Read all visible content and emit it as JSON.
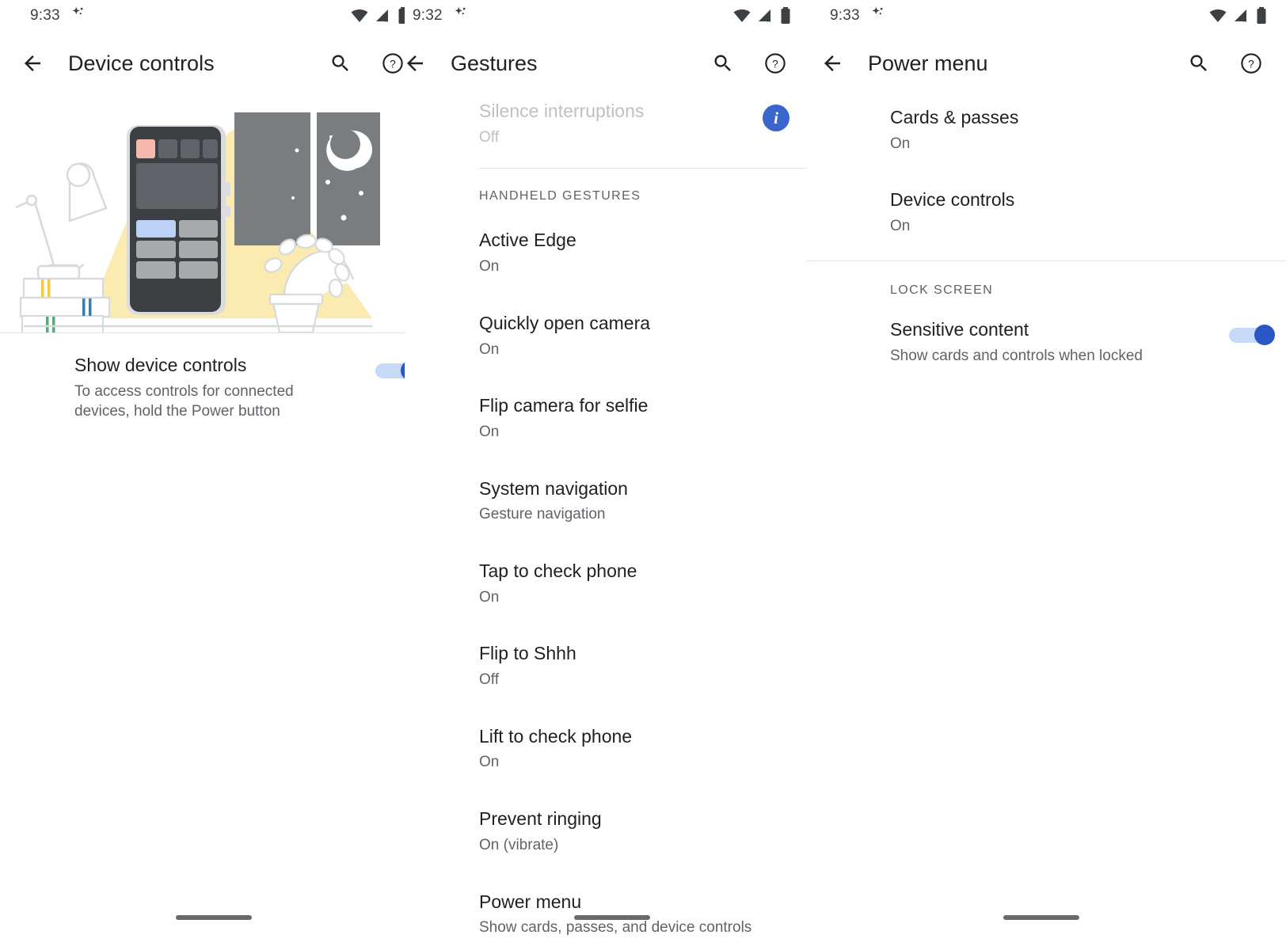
{
  "panels": [
    {
      "status": {
        "time": "9:33",
        "sparkle": "sparkle-icon",
        "wifi": "wifi-icon",
        "signal": "cell-signal-x-icon",
        "battery": "battery-icon"
      },
      "appbar": {
        "back": "back-arrow-icon",
        "title": "Device controls",
        "search": "search-icon",
        "help": "help-circle-icon"
      },
      "illustration": {
        "name": "device-controls-illustration",
        "alt": "Phone showing device control tiles with lamp, books, plant and night window"
      },
      "setting": {
        "title": "Show device controls",
        "subtitle": "To access controls for connected devices, hold the Power button",
        "toggle_on": true
      }
    },
    {
      "status": {
        "time": "9:32",
        "sparkle": "sparkle-icon",
        "wifi": "wifi-icon",
        "signal": "cell-signal-x-icon",
        "battery": "battery-icon"
      },
      "appbar": {
        "back": "back-arrow-icon",
        "title": "Gestures",
        "search": "search-icon",
        "help": "help-circle-icon"
      },
      "top_item": {
        "title": "Silence interruptions",
        "subtitle": "Off",
        "disabled": true,
        "info_badge": "i"
      },
      "section_label": "HANDHELD GESTURES",
      "items": [
        {
          "title": "Active Edge",
          "subtitle": "On"
        },
        {
          "title": "Quickly open camera",
          "subtitle": "On"
        },
        {
          "title": "Flip camera for selfie",
          "subtitle": "On"
        },
        {
          "title": "System navigation",
          "subtitle": "Gesture navigation"
        },
        {
          "title": "Tap to check phone",
          "subtitle": "On"
        },
        {
          "title": "Flip to Shhh",
          "subtitle": "Off"
        },
        {
          "title": "Lift to check phone",
          "subtitle": "On"
        },
        {
          "title": "Prevent ringing",
          "subtitle": "On (vibrate)"
        },
        {
          "title": "Power menu",
          "subtitle": "Show cards, passes, and device controls"
        }
      ]
    },
    {
      "status": {
        "time": "9:33",
        "sparkle": "sparkle-icon",
        "wifi": "wifi-icon",
        "signal": "cell-signal-x-icon",
        "battery": "battery-icon"
      },
      "appbar": {
        "back": "back-arrow-icon",
        "title": "Power menu",
        "search": "search-icon",
        "help": "help-circle-icon"
      },
      "items": [
        {
          "title": "Cards & passes",
          "subtitle": "On"
        },
        {
          "title": "Device controls",
          "subtitle": "On"
        }
      ],
      "section_label": "LOCK SCREEN",
      "lock_setting": {
        "title": "Sensitive content",
        "subtitle": "Show cards and controls when locked",
        "toggle_on": true
      }
    }
  ],
  "colors": {
    "accent_blue": "#2a56c6",
    "toggle_track": "#c6d9f7",
    "info_blue": "#3a66cc",
    "text_primary": "#202124",
    "text_secondary": "#5f6368",
    "divider": "#e3e5e8"
  }
}
